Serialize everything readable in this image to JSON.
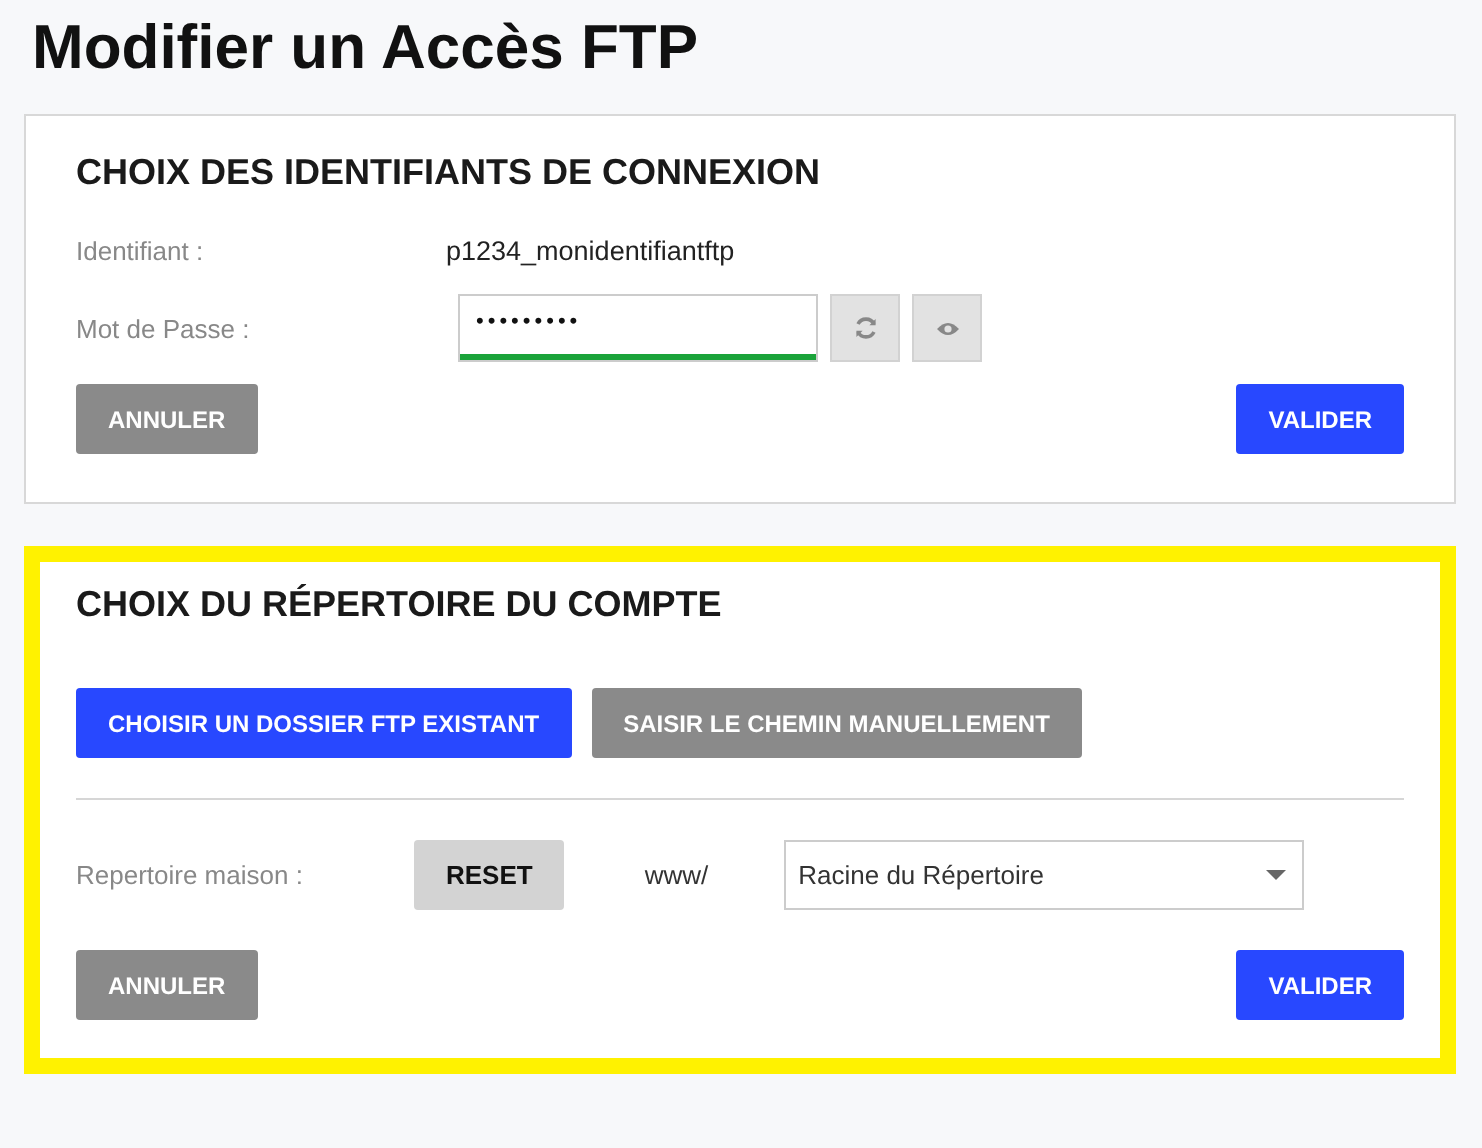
{
  "page_title": "Modifier un Accès FTP",
  "credentials": {
    "title": "CHOIX DES IDENTIFIANTS DE CONNEXION",
    "highlighted": false,
    "identifier_label": "Identifiant :",
    "identifier_value": "p1234_monidentifiantftp",
    "password_label": "Mot de Passe :",
    "password_value": "•••••••••",
    "password_strength": {
      "level": 1
    },
    "cancel": "ANNULER",
    "submit": "VALIDER"
  },
  "directory": {
    "title": "CHOIX DU RÉPERTOIRE DU COMPTE",
    "highlighted": true,
    "modes": [
      {
        "label": "CHOISIR UN DOSSIER FTP EXISTANT",
        "selected": true
      },
      {
        "label": "SAISIR LE CHEMIN MANUELLEMENT",
        "selected": false
      }
    ],
    "home_label": "Repertoire maison :",
    "reset": "RESET",
    "prefix": "www/",
    "folder_value": "Racine du Répertoire",
    "cancel": "ANNULER",
    "submit": "VALIDER"
  }
}
